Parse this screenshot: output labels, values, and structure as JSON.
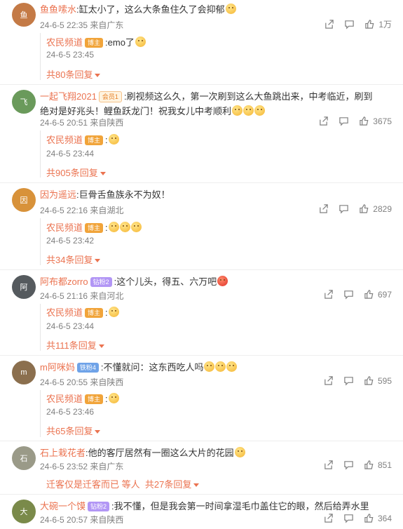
{
  "comments": [
    {
      "user": "鱼鱼嗦水",
      "badge": "",
      "text": ":缸太小了，这么大条鱼住久了会抑郁",
      "time": "24-6-5 22:35",
      "location": "来自广东",
      "likes": "1万",
      "reply_user": "农民频道",
      "reply_badge": "博主",
      "reply_text": ":emo了",
      "reply_time": "24-6-5 23:45",
      "more": "共80条回复"
    },
    {
      "user": "一起飞翔2021",
      "badge": "会员1",
      "text": ":刷视频这么久，第一次刷到这么大鱼跳出来，中考临近，刷到绝对是好兆头！鲤鱼跃龙门！祝我女儿中考顺利",
      "time": "24-6-5 20:51",
      "location": "来自陕西",
      "likes": "3675",
      "reply_user": "农民频道",
      "reply_badge": "博主",
      "reply_text": ":",
      "reply_time": "24-6-5 23:44",
      "more": "共905条回复"
    },
    {
      "user": "因为遥远",
      "badge": "",
      "text": ":巨骨舌鱼族永不为奴！",
      "time": "24-6-5 22:16",
      "location": "来自湖北",
      "likes": "2829",
      "reply_user": "农民频道",
      "reply_badge": "博主",
      "reply_text": ":",
      "reply_time": "24-6-5 23:42",
      "more": "共34条回复"
    },
    {
      "user": "阿布都zorro",
      "badge": "钻粉2",
      "text": ":这个儿头，得五、六万吧",
      "time": "24-6-5 21:16",
      "location": "来自河北",
      "likes": "697",
      "reply_user": "农民频道",
      "reply_badge": "博主",
      "reply_text": ":",
      "reply_time": "24-6-5 23:44",
      "more": "共111条回复"
    },
    {
      "user": "m阿咪妈",
      "badge": "铁粉4",
      "text": ":不懂就问：这东西吃人吗",
      "time": "24-6-5 20:55",
      "location": "来自陕西",
      "likes": "595",
      "reply_user": "农民频道",
      "reply_badge": "博主",
      "reply_text": ":",
      "reply_time": "24-6-5 23:46",
      "more": "共65条回复"
    },
    {
      "user": "石上栽花者",
      "badge": "",
      "text": ":他的客厅居然有一圈这么大片的花园",
      "time": "24-6-5 23:52",
      "location": "来自广东",
      "likes": "851",
      "reply_user": "",
      "reply_badge": "",
      "reply_text": "",
      "reply_time": "",
      "more": "共27条回复",
      "extra": "迁客仅是迁客而已 等人"
    },
    {
      "user": "大碗一个馍",
      "badge": "钻粉2",
      "text": ":我不懂，但是我会第一时间拿湿毛巾盖住它的眼，然后给弄水里",
      "time": "24-6-5 20:57",
      "location": "来自陕西",
      "likes": "364"
    }
  ],
  "colors": {
    "accent": "#eb7350",
    "meta": "#808080"
  },
  "icons": [
    "share-icon",
    "comment-icon",
    "like-icon"
  ]
}
